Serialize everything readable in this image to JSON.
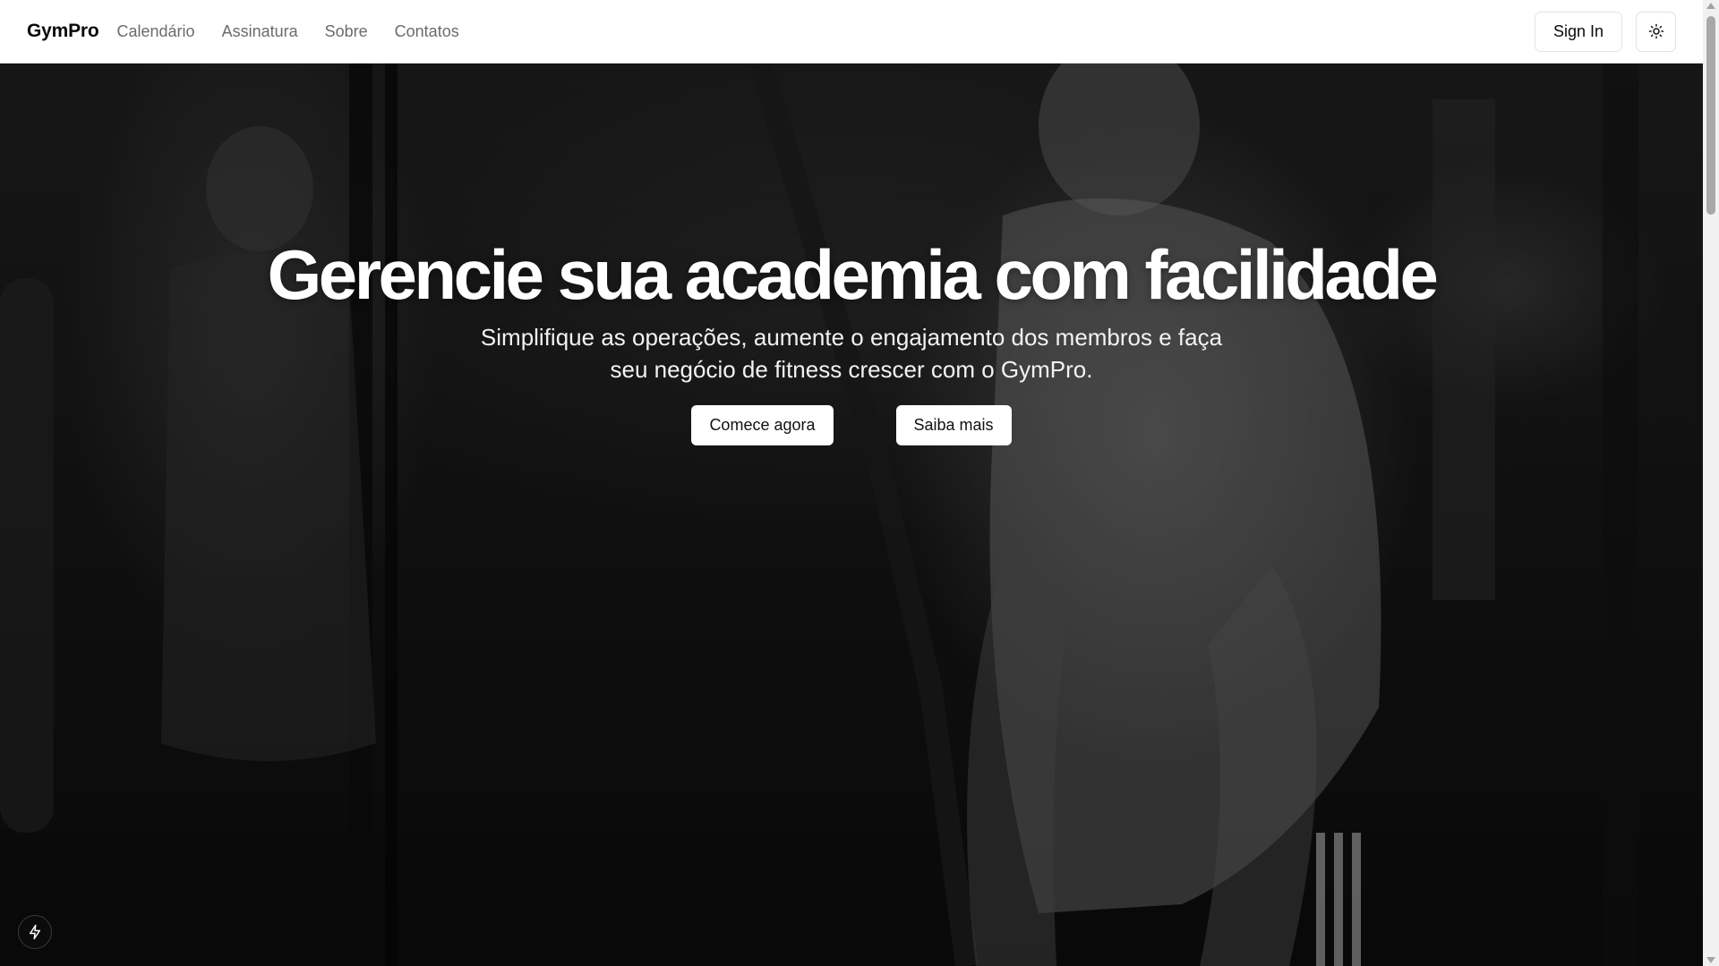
{
  "header": {
    "brand": "GymPro",
    "nav": [
      {
        "label": "Calendário"
      },
      {
        "label": "Assinatura"
      },
      {
        "label": "Sobre"
      },
      {
        "label": "Contatos"
      }
    ],
    "signin_label": "Sign In",
    "theme_icon": "sun-icon"
  },
  "hero": {
    "title": "Gerencie sua academia com facilidade",
    "subtitle": "Simplifique as operações, aumente o engajamento dos membros e faça seu negócio de fitness crescer com o GymPro.",
    "primary_label": "Comece agora",
    "secondary_label": "Saiba mais",
    "background": "black-and-white gym photo"
  },
  "floating": {
    "dev_badge_icon": "lightning-icon"
  },
  "colors": {
    "header_bg": "#ffffff",
    "hero_overlay": "#0a0a0a",
    "text_primary": "#0a0a0a",
    "nav_text": "#6b6b6b",
    "button_bg": "#ffffff"
  }
}
